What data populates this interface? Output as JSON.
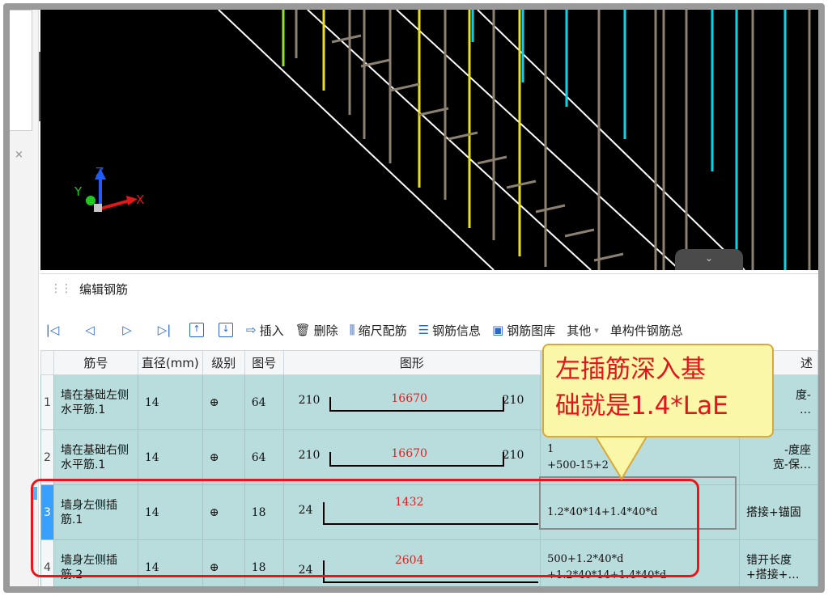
{
  "sidebar": {
    "close_glyph": "×",
    "collapse_glyph": "‹"
  },
  "viewport": {
    "axis": {
      "x": "X",
      "y": "Y",
      "z": "Z"
    },
    "collapse_glyph": "⌄",
    "colors": {
      "background": "#000000",
      "rebar_gray": "#8c8070",
      "rebar_yellow": "#e8e020",
      "rebar_cyan": "#00d8e8",
      "edge_white": "#ffffff"
    }
  },
  "panel": {
    "title": "编辑钢筋",
    "toolbar": {
      "first_icon": "first-icon",
      "prev_icon": "prev-icon",
      "next_icon": "next-icon",
      "last_icon": "last-icon",
      "move_up_glyph": "↑",
      "move_down_glyph": "↓",
      "insert": "插入",
      "delete": "删除",
      "scale_rebar": "缩尺配筋",
      "rebar_info": "钢筋信息",
      "rebar_library": "钢筋图库",
      "other": "其他",
      "other_arrow": "▾",
      "single_member": "单构件钢筋总"
    },
    "columns": {
      "bar_no": "筋号",
      "diameter": "直径(mm)",
      "grade": "级别",
      "shape_no": "图号",
      "shape": "图形",
      "desc": "述"
    },
    "rows": [
      {
        "num": "1",
        "name": "墙在基础左侧水平筋.1",
        "diameter": "14",
        "grade": "⊕",
        "shape_no": "64",
        "left": "210",
        "length": "16670",
        "right": "210",
        "formula_line1": "",
        "formula_line2": "",
        "desc_line1": "度-",
        "desc_line2": "…"
      },
      {
        "num": "2",
        "name": "墙在基础右侧水平筋.1",
        "diameter": "14",
        "grade": "⊕",
        "shape_no": "64",
        "left": "210",
        "length": "16670",
        "right": "210",
        "formula_line1": "1",
        "formula_line2": "+500-15+2",
        "desc_line1": "-度座",
        "desc_line2": "宽-保…"
      },
      {
        "num": "3",
        "name": "墙身左侧插筋.1",
        "diameter": "14",
        "grade": "⊕",
        "shape_no": "18",
        "left": "24",
        "length": "1432",
        "formula_line1": "1.2*40*14+1.4*40*d",
        "formula_line2": "",
        "desc_line1": "搭接+锚固",
        "desc_line2": ""
      },
      {
        "num": "4",
        "name": "墙身左侧插筋.2",
        "diameter": "14",
        "grade": "⊕",
        "shape_no": "18",
        "left": "24",
        "length": "2604",
        "formula_line1": "500+1.2*40*d",
        "formula_line2": "+1.2*40*14+1.4*40*d",
        "desc_line1": "错开长度",
        "desc_line2": "+搭接+…"
      }
    ]
  },
  "callout": {
    "line1": "左插筋深入基",
    "line2": "础就是1.4*LaE",
    "text_color": "#e2141c",
    "fill": "#fbf7a8"
  },
  "highlight_color": "#e8161c"
}
